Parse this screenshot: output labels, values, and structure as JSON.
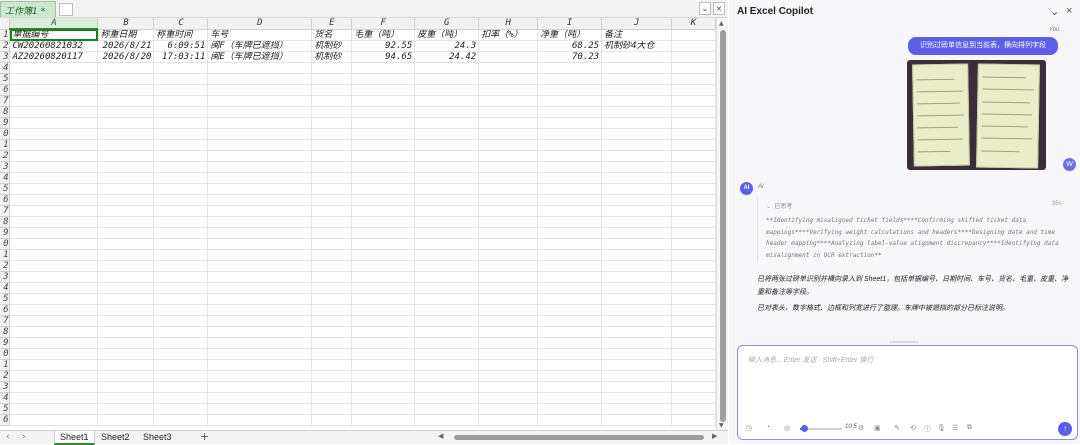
{
  "workbook": {
    "tab_name": "工作簿1",
    "modified_mark": "*",
    "tab_controls": [
      "⌄",
      "×"
    ]
  },
  "sheet": {
    "columns": [
      "A",
      "B",
      "C",
      "D",
      "E",
      "F",
      "G",
      "H",
      "I",
      "J",
      "K"
    ],
    "active_column": "A",
    "rows": [
      [
        "单据编号",
        "称重日期",
        "称重时间",
        "车号",
        "货名",
        "毛重（吨）",
        "皮重（吨）",
        "扣率（%）",
        "净重（吨）",
        "备注",
        ""
      ],
      [
        "CW20260821032",
        "2026/8/21",
        "6:09:51",
        "闽F（车牌已遮挡）",
        "机制砂",
        "92.55",
        "24.3",
        "",
        "68.25",
        "机制砂4大仓",
        ""
      ],
      [
        "AZ20260820117",
        "2026/8/20",
        "17:03:11",
        "闽E（车牌已遮挡）",
        "机制砂",
        "94.65",
        "24.42",
        "",
        "70.23",
        "",
        ""
      ]
    ],
    "numeric_columns": [
      1,
      2,
      5,
      6,
      8
    ],
    "row_numbers": [
      "1",
      "2",
      "3",
      "4",
      "5",
      "6",
      "7",
      "8",
      "9",
      "0",
      "1",
      "2",
      "3",
      "4",
      "5",
      "6",
      "7",
      "8",
      "9",
      "0",
      "1",
      "2",
      "3",
      "4",
      "5",
      "6",
      "7",
      "8",
      "9",
      "0",
      "1",
      "2",
      "3",
      "4",
      "5",
      "6"
    ],
    "selected_cell": "A1"
  },
  "sheet_tabs": {
    "items": [
      "Sheet1",
      "Sheet2",
      "Sheet3"
    ],
    "active": "Sheet1",
    "add_label": "+",
    "nav_prev": "‹",
    "nav_next": "›"
  },
  "copilot": {
    "title": "AI Excel Copilot",
    "header_controls": [
      "⌄",
      "×"
    ],
    "user_label": "You",
    "user_message": "识别过磅单信息到当前表，横向排列字段",
    "user_avatar": "W",
    "ai_avatar": "AI",
    "ai_label": "AI",
    "thinking_label": "已思考",
    "thinking_chevron": "⌄",
    "thinking_time": "35s",
    "thinking_text": "**Identifying misaligned ticket fields****Confirming shifted ticket data mappings****Verifying weight calculations and headers****Designing date and time header mapping****Analyzing label-value alignment discrepancy****Identifying data misalignment in OCR extraction**",
    "answer_1": "已将两张过磅单识别并横向录入到 Sheet1，包括单据编号、日期时间、车号、货名、毛重、皮重、净重和备注等字段。",
    "answer_2": "已对表头、数字格式、边框和列宽进行了整理。车牌中被遮挡的部分已标注说明。",
    "input_placeholder": "输入消息... Enter 发送 · Shift+Enter 换行",
    "temperature": 0.1,
    "temperature_label": "10.5",
    "send_icon": "↑",
    "toolbar_icons": [
      "◷",
      "◔",
      "◎",
      "⚙",
      "▣",
      "✎",
      "⟲",
      "ⓘ",
      "🎙",
      "☰",
      "⧉"
    ]
  }
}
